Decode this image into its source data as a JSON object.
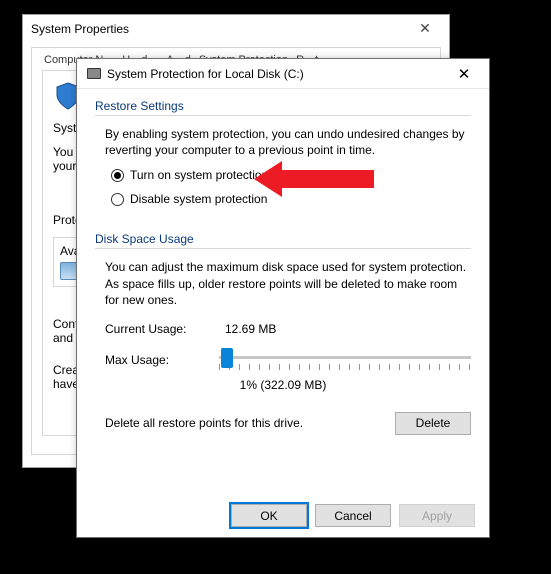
{
  "back": {
    "title": "System Properties",
    "tabs": [
      "Computer N…",
      "H…d…",
      "A…d",
      "System Protection",
      "R…t"
    ],
    "blurb": "System",
    "line1": "You ca",
    "line2": "your co",
    "protect_label": "Protect",
    "ava": "Ava",
    "confi": "Confi",
    "and_c": "and c",
    "creat": "Creat",
    "have": "have"
  },
  "front": {
    "title": "System Protection for Local Disk (C:)",
    "restore_header": "Restore Settings",
    "restore_help": "By enabling system protection, you can undo undesired changes by reverting your computer to a previous point in time.",
    "radio_on": "Turn on system protection",
    "radio_off": "Disable system protection",
    "disk_header": "Disk Space Usage",
    "disk_help": "You can adjust the maximum disk space used for system protection. As space fills up, older restore points will be deleted to make room for new ones.",
    "current_label": "Current Usage:",
    "current_value": "12.69 MB",
    "max_label": "Max Usage:",
    "slider_value": "1% (322.09 MB)",
    "delete_help": "Delete all restore points for this drive.",
    "delete_btn": "Delete",
    "ok_btn": "OK",
    "cancel_btn": "Cancel",
    "apply_btn": "Apply"
  }
}
